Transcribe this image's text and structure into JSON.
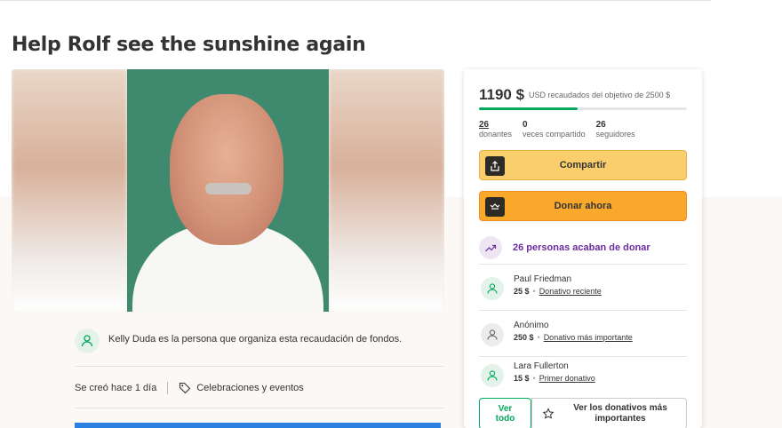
{
  "campaign": {
    "title": "Help Rolf see the sunshine again",
    "organizer_text": "Kelly Duda es la persona que organiza esta recaudación de fondos.",
    "created": "Se creó hace 1 día",
    "category": "Celebraciones y eventos"
  },
  "summary": {
    "amount": "1190 $",
    "amount_sub": "USD recaudados del objetivo de 2500 $",
    "progress_fraction": 0.476,
    "stats": [
      {
        "num": "26",
        "label": "donantes"
      },
      {
        "num": "0",
        "label": "veces compartido"
      },
      {
        "num": "26",
        "label": "seguidores"
      }
    ],
    "share_label": "Compartir",
    "donate_label": "Donar ahora",
    "recent_label": "26 personas acaban de donar",
    "donors": [
      {
        "name": "Paul Friedman",
        "amount": "25 $",
        "tag": "Donativo reciente"
      },
      {
        "name": "Anónimo",
        "amount": "250 $",
        "tag": "Donativo más importante"
      },
      {
        "name": "Lara Fullerton",
        "amount": "15 $",
        "tag": "Primer donativo"
      }
    ],
    "see_all_label": "Ver todo",
    "see_top_label": "Ver los donativos más importantes"
  },
  "colors": {
    "accent_green": "#02a95c",
    "share_yellow": "#fbce6d",
    "donate_orange": "#f9a82c",
    "recent_purple": "#6c2ba0"
  }
}
